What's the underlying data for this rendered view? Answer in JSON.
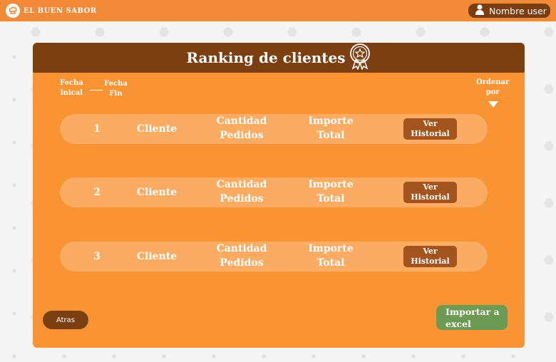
{
  "app": {
    "brand": "EL BUEN SABOR"
  },
  "header": {
    "user_label": "Nombre user"
  },
  "panel": {
    "title": "Ranking de clientes",
    "filters": {
      "fecha_inicial": [
        "Fecha",
        "inical"
      ],
      "fecha_fin": [
        "Fecha",
        "Fin"
      ],
      "ordenar": [
        "Ordenar",
        "por"
      ]
    },
    "rows": [
      {
        "rank": "1",
        "cliente": "Cliente",
        "cantidad": [
          "Cantidad",
          "Pedidos"
        ],
        "importe": [
          "Importe",
          "Total"
        ],
        "button": [
          "Ver",
          "Historial"
        ]
      },
      {
        "rank": "2",
        "cliente": "Cliente",
        "cantidad": [
          "Cantidad",
          "Pedidos"
        ],
        "importe": [
          "Importe",
          "Total"
        ],
        "button": [
          "Ver",
          "Historial"
        ]
      },
      {
        "rank": "3",
        "cliente": "Cliente",
        "cantidad": [
          "Cantidad",
          "Pedidos"
        ],
        "importe": [
          "Importe",
          "Total"
        ],
        "button": [
          "Ver",
          "Historial"
        ]
      }
    ],
    "back_label": "Atras",
    "export_label": [
      "Importar a",
      "excel"
    ]
  },
  "colors": {
    "topbar": "#f28a38",
    "panel": "#f89433",
    "panel_header": "#7c3f12",
    "row": "#fbab62",
    "history_button": "#a2541c",
    "export_button": "#6c9a52"
  },
  "icons": {
    "brand": "chef-hat-icon",
    "user": "user-icon",
    "title_badge": "award-medal-icon",
    "sort": "triangle-down-icon"
  }
}
